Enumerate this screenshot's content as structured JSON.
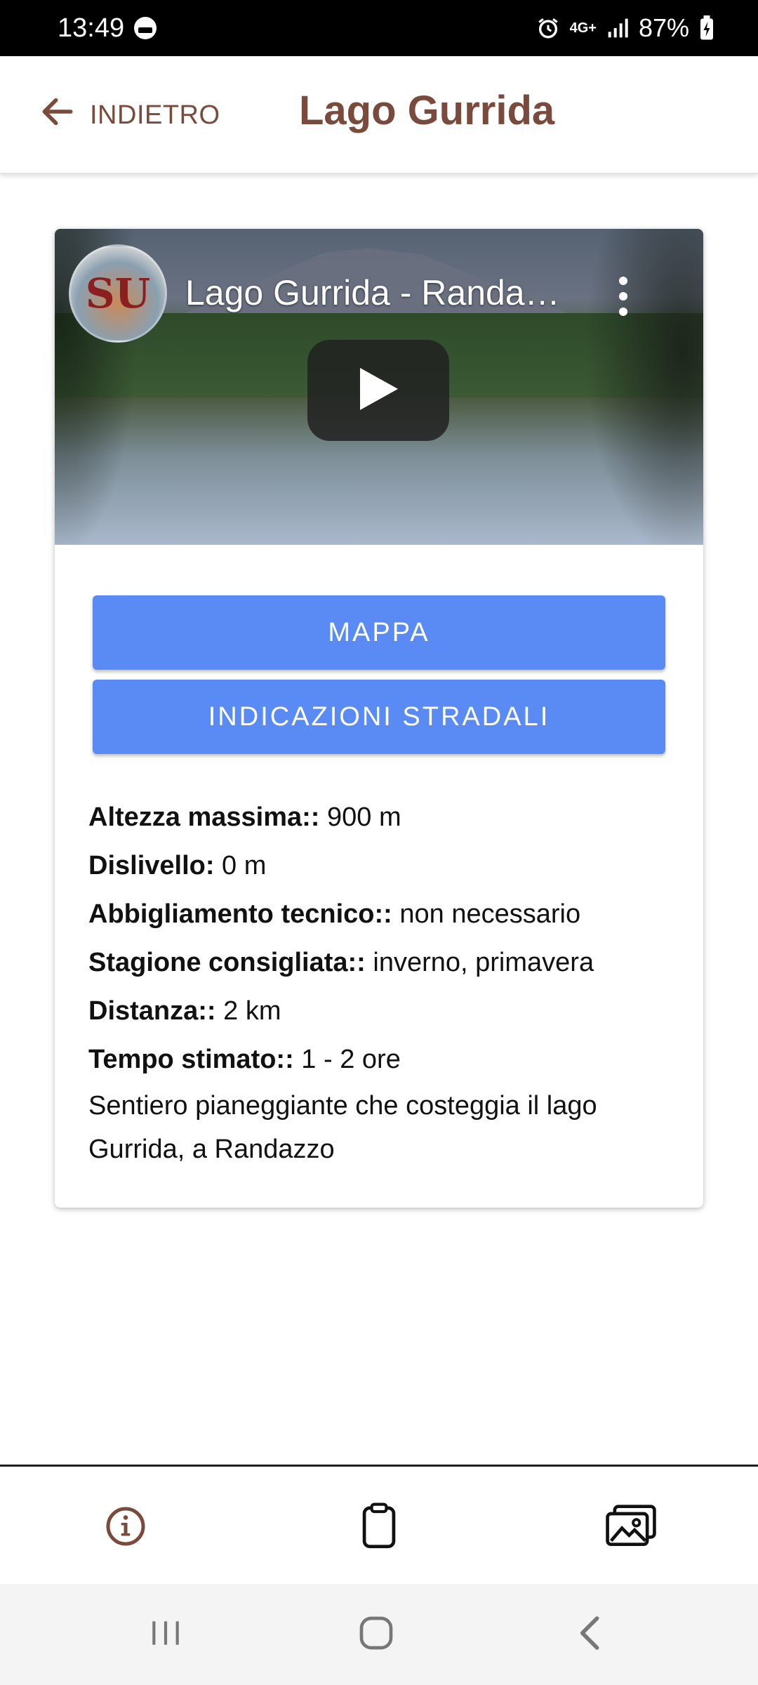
{
  "status_bar": {
    "time": "13:49",
    "network": "4G+",
    "battery": "87%"
  },
  "header": {
    "back_label": "INDIETRO",
    "title": "Lago Gurrida"
  },
  "video": {
    "title": "Lago Gurrida - Randa…",
    "channel_logo_text": "SU"
  },
  "buttons": {
    "mappa": "MAPPA",
    "indicazioni": "INDICAZIONI STRADALI"
  },
  "details": [
    {
      "label": "Altezza massima::",
      "value": " 900 m"
    },
    {
      "label": "Dislivello:",
      "value": " 0 m"
    },
    {
      "label": "Abbigliamento tecnico::",
      "value": " non necessario"
    },
    {
      "label": "Stagione consigliata::",
      "value": " inverno, primavera"
    },
    {
      "label": "Distanza::",
      "value": " 2 km"
    },
    {
      "label": "Tempo stimato::",
      "value": " 1 - 2 ore"
    }
  ],
  "description": "Sentiero pianeggiante che costeggia il lago Gurrida, a Randazzo",
  "colors": {
    "brand_brown": "#7a4a3c",
    "button_blue": "#5a8bf5"
  },
  "bottom_nav": {
    "items": [
      "info-icon",
      "clipboard-icon",
      "gallery-icon"
    ]
  }
}
